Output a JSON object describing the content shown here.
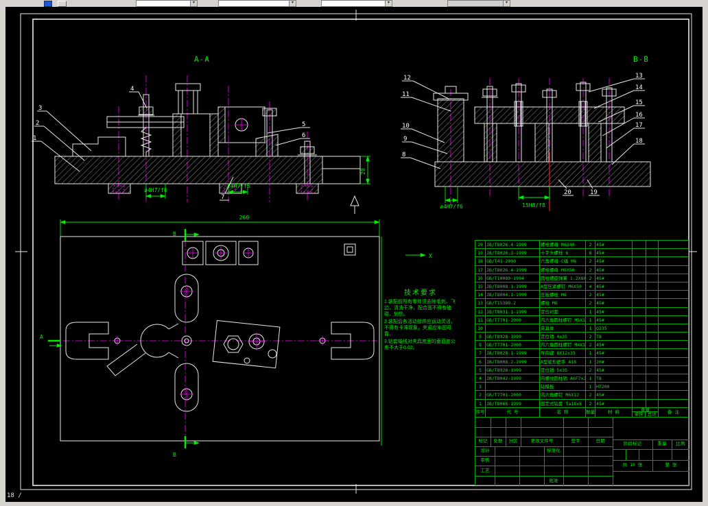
{
  "window": {
    "status_text": "18 /"
  },
  "drawing": {
    "labels": {
      "section_aa": "A-A",
      "section_bb": "B-B",
      "cut_a": "A",
      "cut_b_top": "B",
      "cut_b_bottom": "B",
      "view_x": "X"
    },
    "balloons": [
      "1",
      "2",
      "3",
      "4",
      "5",
      "6",
      "7",
      "8",
      "9",
      "10",
      "11",
      "12",
      "13",
      "14",
      "15",
      "16",
      "17",
      "18",
      "19",
      "20"
    ],
    "dims": {
      "plate_width": "260",
      "step_height": "20",
      "pin_fit_aa_left": "ø4H7/f6",
      "pin_fit_aa_right": "ø4H7/f6",
      "pin_fit_bb": "ø4H7/f6",
      "slot_fit_bb": "15H8/f8"
    },
    "tech_req": {
      "title": "技术要求",
      "items": [
        "1.装配前所有零件须去除毛刺、飞边，清洗干净，配合面不得有磕碰、划伤。",
        "2.装配后各活动部件应运动灵活，不得有卡滞现象，夹紧应牢固可靠。",
        "3.钻套轴线对夹具底面的垂直度公差不大于0.02。"
      ]
    }
  },
  "parts": {
    "header": {
      "no": "序号",
      "code": "代 号",
      "name": "名 称",
      "qty": "数量",
      "mat": "材 料",
      "weight": "重量",
      "single": "单件",
      "total": "总计",
      "remark": "备 注"
    },
    "rows": [
      {
        "no": "20",
        "code": "JB/T8026.4-1999",
        "name": "螺栓螺母 M6X40",
        "qty": "2",
        "mat": "45#"
      },
      {
        "no": "19",
        "code": "JB/T8026.3-1999",
        "name": "十字头螺栓 6",
        "qty": "8",
        "mat": "45#"
      },
      {
        "no": "18",
        "code": "GB/T41-2000",
        "name": "六角螺母-C级 M6",
        "qty": "2",
        "mat": "45#"
      },
      {
        "no": "17",
        "code": "JB/T8026.4-1999",
        "name": "螺栓螺母 M6X50",
        "qty": "2",
        "mat": "45#"
      },
      {
        "no": "16",
        "code": "GB/T10089-1994",
        "name": "圆柱螺旋弹簧 1.2X8X25",
        "qty": "2",
        "mat": "45#"
      },
      {
        "no": "15",
        "code": "JB/T8008.1-1999",
        "name": "A型压紧螺钉 M6X50",
        "qty": "4",
        "mat": "45#"
      },
      {
        "no": "14",
        "code": "JB/T8004.1-1999",
        "name": "压板螺栓 M6",
        "qty": "2",
        "mat": "45#"
      },
      {
        "no": "13",
        "code": "GB/T15389.2",
        "name": "螺柱 M6",
        "qty": "2",
        "mat": "45#"
      },
      {
        "no": "12",
        "code": "JB/T8031.1-1999",
        "name": "定位衬套",
        "qty": "1",
        "mat": "45#"
      },
      {
        "no": "11",
        "code": "GB/T7701-2000",
        "name": "内六角圆柱螺钉 M5X10",
        "qty": "1",
        "mat": "45#"
      },
      {
        "no": "10",
        "code": "",
        "name": "夹具体",
        "qty": "1",
        "mat": "Q235"
      },
      {
        "no": "9",
        "code": "GB/T8928-1999",
        "name": "定位销 4x35",
        "qty": "2",
        "mat": "T8"
      },
      {
        "no": "8",
        "code": "GB/T7701-2000",
        "name": "内六角圆柱螺钉 M4X12",
        "qty": "2",
        "mat": "45#"
      },
      {
        "no": "7",
        "code": "JB/T8028.1-1999",
        "name": "导向键 8X12x35",
        "qty": "1",
        "mat": "45#"
      },
      {
        "no": "6",
        "code": "JB/T8008.2-1999",
        "name": "A型星形把手 A18",
        "qty": "1",
        "mat": "20#"
      },
      {
        "no": "5",
        "code": "GB/T8928-1999",
        "name": "定位销 5x35",
        "qty": "2",
        "mat": "45#"
      },
      {
        "no": "4",
        "code": "JB/T8042-1999",
        "name": "内螺纹圆柱销 A6F7x35",
        "qty": "1",
        "mat": "T8"
      },
      {
        "no": "3",
        "code": "",
        "name": "钻模板",
        "qty": "1",
        "mat": "HT200"
      },
      {
        "no": "2",
        "code": "GB/T7701-2000",
        "name": "内六角螺钉 M6X12",
        "qty": "2",
        "mat": "45#"
      },
      {
        "no": "1",
        "code": "JB/T8066-1999",
        "name": "固定式钻套 Ta18x8",
        "qty": "2",
        "mat": "45#"
      }
    ]
  },
  "titleblock": {
    "revision_labels": [
      "标记",
      "处数",
      "分区",
      "更改文件号",
      "签字",
      "日期"
    ],
    "sign_labels": [
      "设计",
      "审核",
      "工艺",
      "标准化",
      "批准"
    ],
    "stage_label": "阶段标记",
    "weight_label": "重量",
    "scale_label": "比例",
    "sheet_total_label": "共",
    "sheet_word": "张",
    "sheet_page_label": "第",
    "sheet_word2": "张",
    "sheet_value": "10"
  }
}
